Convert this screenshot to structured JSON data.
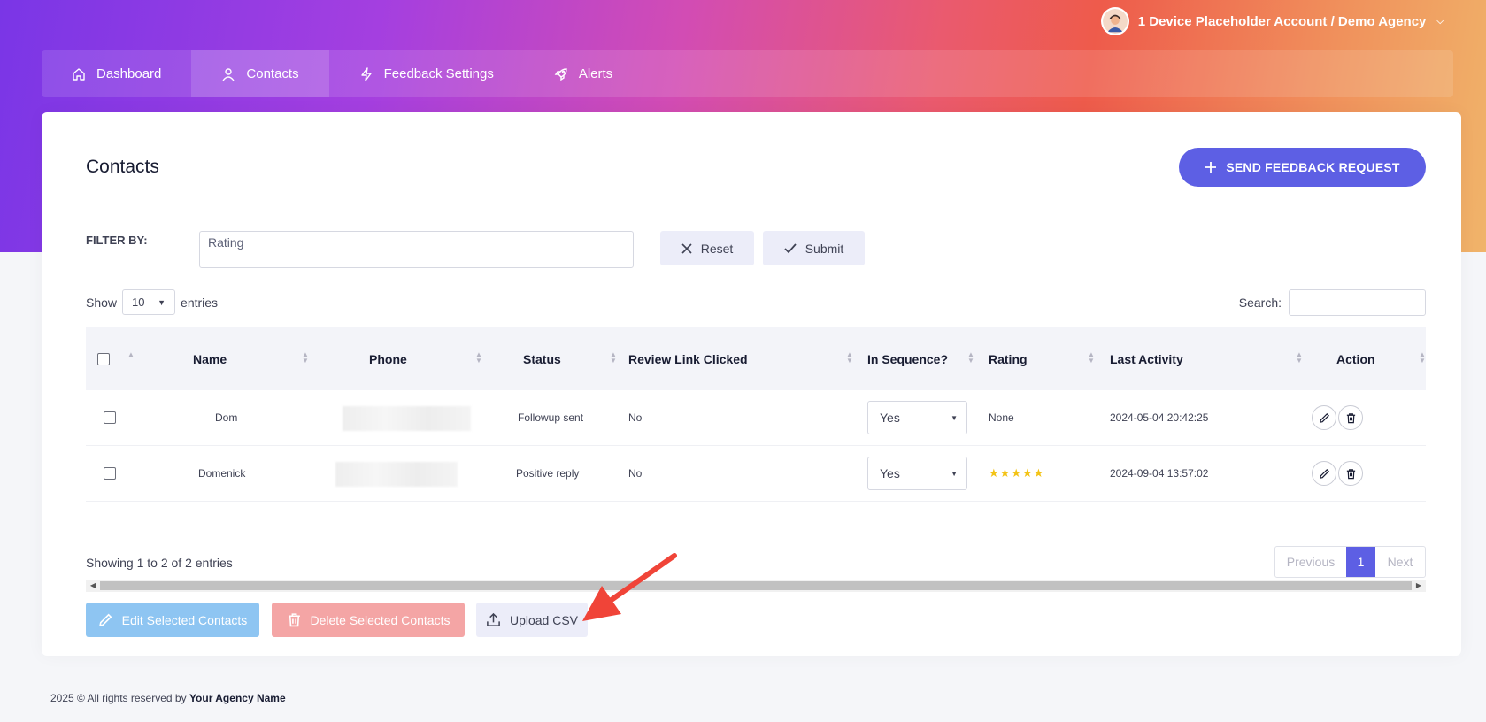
{
  "account": {
    "label": "1 Device Placeholder Account / Demo Agency"
  },
  "nav": {
    "items": [
      {
        "label": "Dashboard",
        "icon": "home-icon"
      },
      {
        "label": "Contacts",
        "icon": "user-icon"
      },
      {
        "label": "Feedback Settings",
        "icon": "bolt-icon"
      },
      {
        "label": "Alerts",
        "icon": "rocket-icon"
      }
    ],
    "active": "Contacts"
  },
  "page": {
    "title": "Contacts",
    "send_label": "SEND FEEDBACK REQUEST"
  },
  "filter": {
    "label": "FILTER BY:",
    "value": "Rating",
    "reset_label": "Reset",
    "submit_label": "Submit"
  },
  "table_controls": {
    "show_label": "Show",
    "entries_value": "10",
    "entries_label": "entries",
    "search_label": "Search:"
  },
  "table": {
    "columns": [
      "Name",
      "Phone",
      "Status",
      "Review Link Clicked",
      "In Sequence?",
      "Rating",
      "Last Activity",
      "Action"
    ],
    "rows": [
      {
        "name": "Dom",
        "status": "Followup sent",
        "review_clicked": "No",
        "in_sequence": "Yes",
        "rating_text": "None",
        "rating_stars": 0,
        "last_activity": "2024-05-04 20:42:25"
      },
      {
        "name": "Domenick",
        "status": "Positive reply",
        "review_clicked": "No",
        "in_sequence": "Yes",
        "rating_text": "",
        "rating_stars": 5,
        "last_activity": "2024-09-04 13:57:02"
      }
    ]
  },
  "pagination": {
    "info": "Showing 1 to 2 of 2 entries",
    "previous": "Previous",
    "current": "1",
    "next": "Next"
  },
  "actions": {
    "edit_label": "Edit Selected Contacts",
    "delete_label": "Delete Selected Contacts",
    "upload_label": "Upload CSV"
  },
  "footer": {
    "prefix": "2025 © All rights reserved by",
    "agency": "Your Agency Name"
  },
  "colors": {
    "accent": "#5d5fe4",
    "star": "#f3c316",
    "annotation_arrow": "#f04438"
  }
}
